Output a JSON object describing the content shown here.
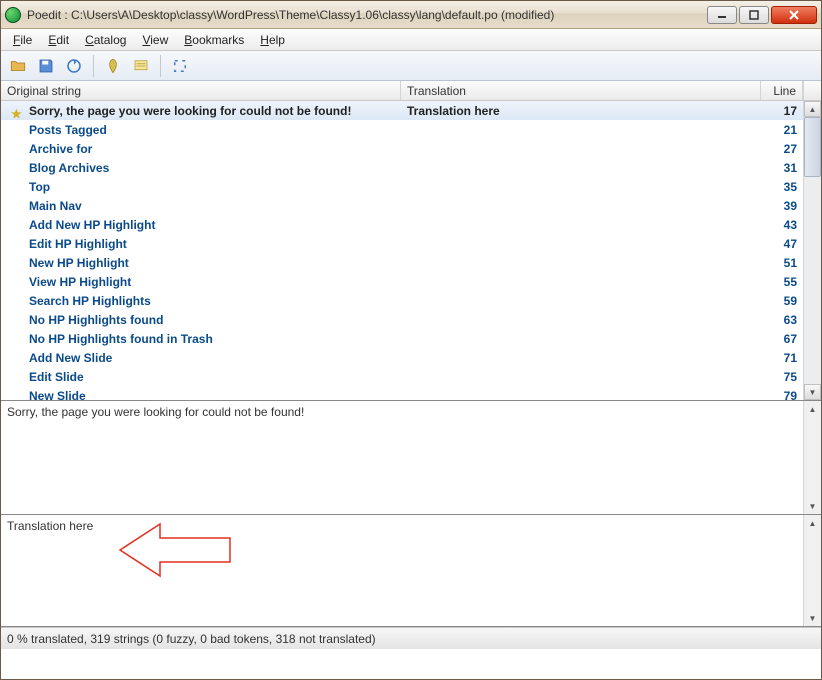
{
  "window": {
    "title": "Poedit : C:\\Users\\A\\Desktop\\classy\\WordPress\\Theme\\Classy1.06\\classy\\lang\\default.po (modified)"
  },
  "menu": {
    "file": "File",
    "edit": "Edit",
    "catalog": "Catalog",
    "view": "View",
    "bookmarks": "Bookmarks",
    "help": "Help"
  },
  "toolbar_icons": {
    "open": "open-folder-icon",
    "save": "save-icon",
    "update": "update-icon",
    "validate": "validate-icon",
    "comment": "comment-icon",
    "fullscreen": "fullscreen-icon"
  },
  "columns": {
    "original": "Original string",
    "translation": "Translation",
    "line": "Line"
  },
  "rows": [
    {
      "original": "Sorry, the page you were looking for could not be found!",
      "translation": "Translation here",
      "line": 17,
      "selected": true,
      "starred": true
    },
    {
      "original": "Posts Tagged",
      "translation": "",
      "line": 21
    },
    {
      "original": "Archive for",
      "translation": "",
      "line": 27
    },
    {
      "original": "Blog Archives",
      "translation": "",
      "line": 31
    },
    {
      "original": "Top",
      "translation": "",
      "line": 35
    },
    {
      "original": "Main Nav",
      "translation": "",
      "line": 39
    },
    {
      "original": "Add New HP Highlight",
      "translation": "",
      "line": 43
    },
    {
      "original": "Edit HP Highlight",
      "translation": "",
      "line": 47
    },
    {
      "original": "New HP Highlight",
      "translation": "",
      "line": 51
    },
    {
      "original": "View HP Highlight",
      "translation": "",
      "line": 55
    },
    {
      "original": "Search HP Highlights",
      "translation": "",
      "line": 59
    },
    {
      "original": "No HP Highlights found",
      "translation": "",
      "line": 63
    },
    {
      "original": "No HP Highlights found in Trash",
      "translation": "",
      "line": 67
    },
    {
      "original": "Add New Slide",
      "translation": "",
      "line": 71
    },
    {
      "original": "Edit Slide",
      "translation": "",
      "line": 75
    },
    {
      "original": "New Slide",
      "translation": "",
      "line": 79
    }
  ],
  "source_text": "Sorry, the page you were looking for could not be found!",
  "translation_text": "Translation here",
  "status": "0 % translated, 319 strings (0 fuzzy, 0 bad tokens, 318 not translated)"
}
